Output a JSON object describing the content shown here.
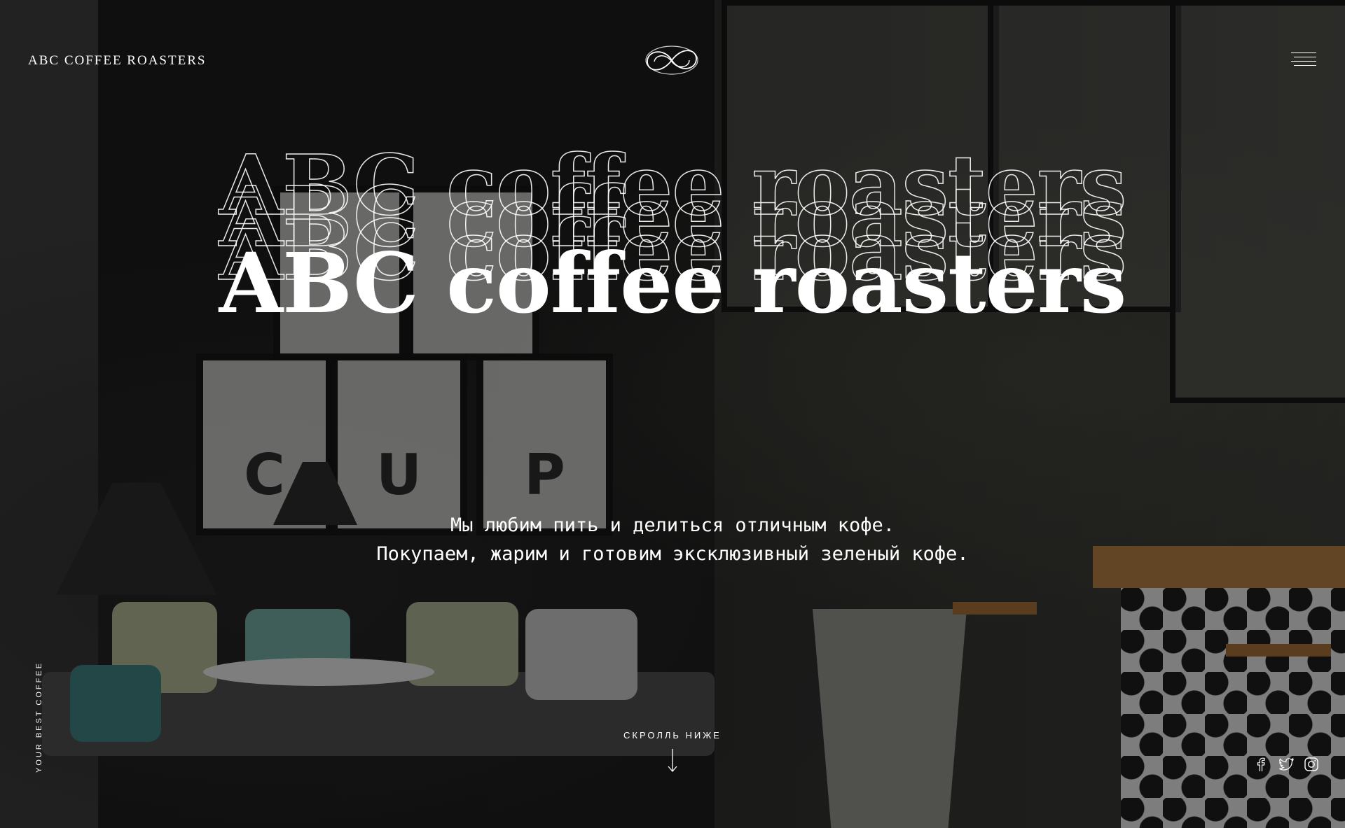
{
  "header": {
    "brand": "ABC COFFEE ROASTERS",
    "logo_icon": "infinity-knot-logo-icon",
    "menu_icon": "hamburger-menu-icon"
  },
  "hero": {
    "title": "ABC coffee roasters",
    "tagline_line1": "Мы любим пить и делиться отличным кофе.",
    "tagline_line2": "Покупаем, жарим и готовим эксклюзивный зеленый кофе."
  },
  "side_text": "YOUR BEST COFFEE",
  "scroll": {
    "label": "СКРОЛЛЬ НИЖЕ",
    "icon": "arrow-down-icon"
  },
  "background_scene": {
    "frame_letters": [
      "C",
      "U",
      "P"
    ]
  },
  "socials": [
    {
      "icon": "facebook-icon"
    },
    {
      "icon": "twitter-icon"
    },
    {
      "icon": "instagram-icon"
    }
  ],
  "colors": {
    "text": "#ffffff",
    "overlay": "#000000"
  }
}
